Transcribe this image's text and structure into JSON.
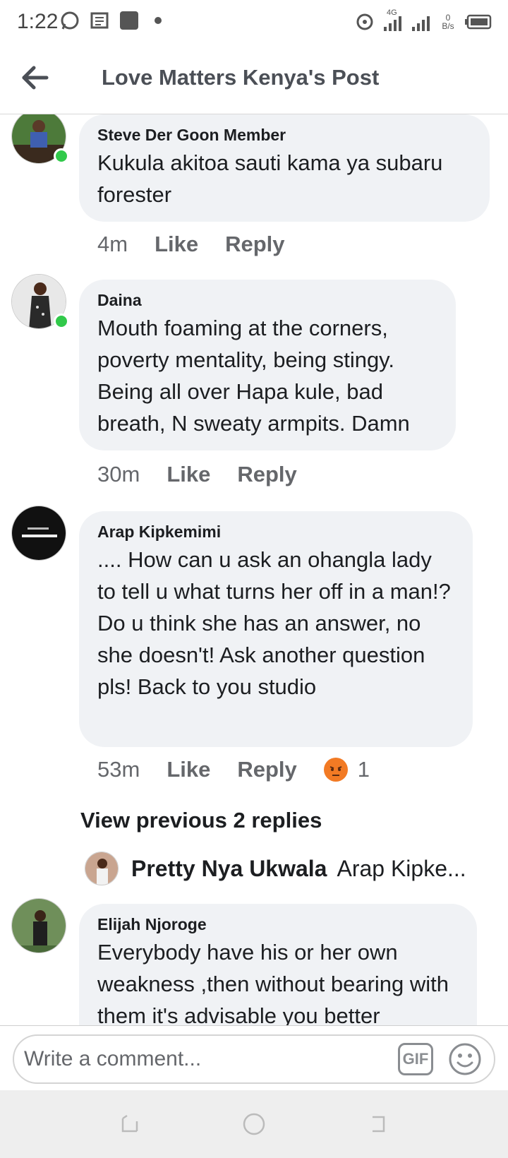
{
  "status_bar": {
    "time": "1:22",
    "network_label": "4G",
    "speed_value": "0",
    "speed_unit": "B/s"
  },
  "header": {
    "title": "Love Matters Kenya's Post"
  },
  "comments": [
    {
      "author": "Steve Der Goon Member",
      "text": "Kukula akitoa sauti kama ya subaru forester",
      "time": "4m",
      "like": "Like",
      "reply": "Reply",
      "online": true
    },
    {
      "author": "Daina",
      "text": "Mouth foaming at the corners, poverty mentality, being stingy. Being all over Hapa kule,  bad breath, N sweaty armpits. Damn",
      "time": "30m",
      "like": "Like",
      "reply": "Reply",
      "online": true
    },
    {
      "author": "Arap Kipkemimi",
      "text": ".... How can u ask an ohangla lady to tell u what turns her off in a man!? Do u think she has an answer, no she doesn't! Ask another question pls! Back to you studio",
      "time": "53m",
      "like": "Like",
      "reply": "Reply",
      "reaction_count": "1",
      "reaction_icon": "angry-reaction-icon",
      "online": false
    },
    {
      "author": "Elijah Njoroge",
      "text": "Everybody have his or her own weakness ,then without bearing with them it's advisable you better",
      "online": false
    }
  ],
  "view_previous": "View previous 2 replies",
  "reply_preview": {
    "name": "Pretty Nya Ukwala",
    "text": "Arap Kipke..."
  },
  "composer": {
    "placeholder": "Write a comment...",
    "gif_label": "GIF"
  },
  "colors": {
    "bubble": "#f0f2f5",
    "online": "#31c94a",
    "muted_text": "#65676b",
    "reaction": "#f27a24"
  }
}
